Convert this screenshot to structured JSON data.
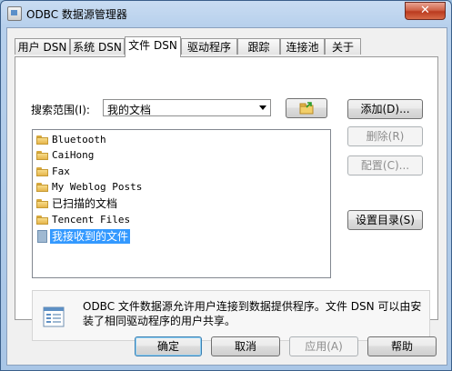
{
  "window": {
    "title": "ODBC 数据源管理器",
    "close_label": "✕"
  },
  "tabs": [
    {
      "label": "用户 DSN"
    },
    {
      "label": "系统 DSN"
    },
    {
      "label": "文件 DSN",
      "active": true
    },
    {
      "label": "驱动程序"
    },
    {
      "label": "跟踪"
    },
    {
      "label": "连接池"
    },
    {
      "label": "关于"
    }
  ],
  "search": {
    "label": "搜索范围(I):",
    "value": "我的文档",
    "up_folder_icon": "folder-up-icon"
  },
  "files": [
    {
      "name": "Bluetooth",
      "type": "folder"
    },
    {
      "name": "CaiHong",
      "type": "folder"
    },
    {
      "name": "Fax",
      "type": "folder"
    },
    {
      "name": "My Weblog Posts",
      "type": "folder"
    },
    {
      "name": "已扫描的文档",
      "type": "folder"
    },
    {
      "name": "Tencent Files",
      "type": "folder"
    },
    {
      "name": "我接收到的文件",
      "type": "file",
      "selected": true
    }
  ],
  "side_buttons": {
    "add": "添加(D)...",
    "remove": "删除(R)",
    "configure": "配置(C)...",
    "set_directory": "设置目录(S)"
  },
  "info": {
    "text": "ODBC 文件数据源允许用户连接到数据提供程序。文件 DSN 可以由安装了相同驱动程序的用户共享。",
    "icon": "document-icon"
  },
  "footer": {
    "ok": "确定",
    "cancel": "取消",
    "apply": "应用(A)",
    "help": "帮助"
  },
  "colors": {
    "selection": "#3399ff",
    "close_button": "#c9452a"
  }
}
